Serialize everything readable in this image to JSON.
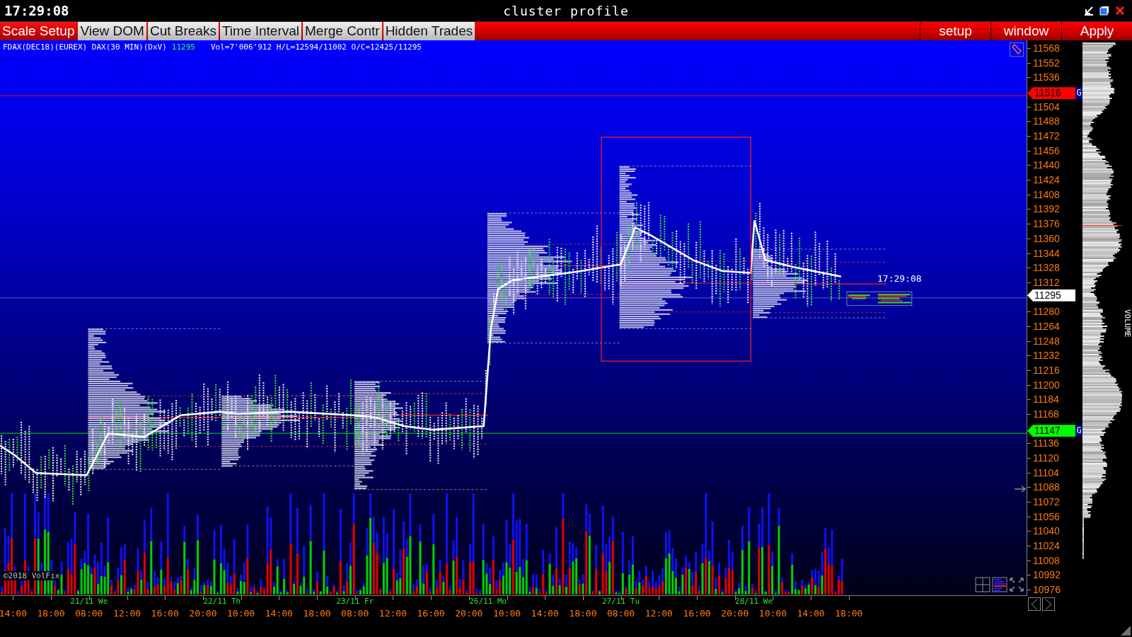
{
  "title_bar": {
    "clock": "17:29:08",
    "title": "cluster profile"
  },
  "toolbar": [
    {
      "label": "Scale Setup",
      "selected": true
    },
    {
      "label": "View DOM",
      "selected": false
    },
    {
      "label": "Cut Breaks",
      "selected": false
    },
    {
      "label": "Time Interval",
      "selected": false
    },
    {
      "label": "Merge Contr",
      "selected": false
    },
    {
      "label": "Hidden Trades",
      "selected": false
    }
  ],
  "right_buttons": [
    "setup",
    "window",
    "Apply"
  ],
  "info": {
    "instrument": "FDAX(DEC18)(EUREX) DAX(30 MIN)(DxV)",
    "last": "11295",
    "stats": "Vol=7'006'912 H/L=12594/11002 O/C=12425/11295"
  },
  "price_axis": [
    "11568",
    "11552",
    "11536",
    "11504",
    "11488",
    "11472",
    "11456",
    "11440",
    "11424",
    "11408",
    "11392",
    "11376",
    "11360",
    "11344",
    "11328",
    "11312",
    "11280",
    "11264",
    "11248",
    "11232",
    "11216",
    "11200",
    "11184",
    "11168",
    "11136",
    "11120",
    "11104",
    "11088",
    "11072",
    "11056",
    "11040",
    "11024",
    "11008",
    "10992",
    "10976"
  ],
  "markers": [
    {
      "price": "11516",
      "color": "#ff0000",
      "badge": "G"
    },
    {
      "price": "11295",
      "color": "#ffffff"
    },
    {
      "price": "11147",
      "color": "#00ff00",
      "badge": "G"
    }
  ],
  "chart_time": "17:29:08",
  "copyright": "©2018 VolFix",
  "volume_label": "VOLUME",
  "time_axis": {
    "dates": [
      "21/11 We",
      "22/11 Th",
      "23/11 Fr",
      "26/11 Mo",
      "27/11 Tu",
      "28/11 We"
    ],
    "times": [
      "14:00",
      "18:00",
      "08:00",
      "12:00",
      "16:00",
      "20:00",
      "10:00",
      "14:00",
      "18:00",
      "08:00",
      "12:00",
      "16:00",
      "20:00",
      "10:00",
      "14:00",
      "18:00",
      "08:00",
      "12:00",
      "16:00",
      "20:00",
      "10:00",
      "14:00",
      "18:00"
    ]
  }
}
